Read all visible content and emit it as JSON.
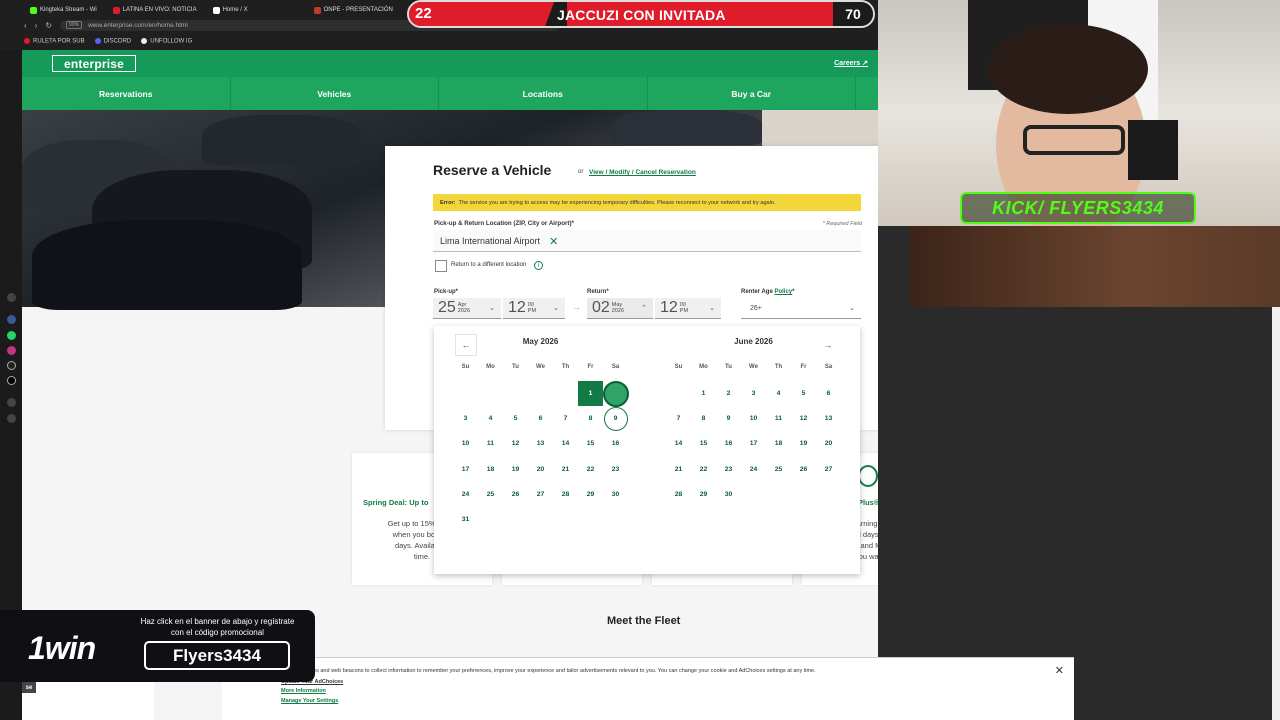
{
  "browser": {
    "tabs": [
      {
        "label": "Kingteka Stream - Wi",
        "color": "#53fc18"
      },
      {
        "label": "LATINA EN VIVO: NOTICIA",
        "color": "#e01b2a"
      },
      {
        "label": "Home / X",
        "color": "#ffffff"
      },
      {
        "label": "ONPE - PRESENTACIÓN",
        "color": "#c0392b"
      }
    ],
    "url": "www.enterprise.com/en/home.html",
    "zoom": "90%",
    "bookmarks": [
      "RULETA POR SUB",
      "DISCORD",
      "UNFOLLOW IG"
    ]
  },
  "site": {
    "logo": "enterprise",
    "careers": "Careers",
    "nav": [
      "Reservations",
      "Vehicles",
      "Locations",
      "Buy a Car"
    ]
  },
  "reservation": {
    "title": "Reserve a Vehicle",
    "or": "or",
    "modify_link": "View / Modify / Cancel Reservation",
    "error_label": "Error:",
    "error_text": "The service you are trying to access may be experiencing temporary difficulties. Please reconnect to your network and try again.",
    "location_label": "Pick-up & Return Location (ZIP, City or Airport)*",
    "required": "* Required Field",
    "location_value": "Lima International Airport",
    "return_diff": "Return to a different location",
    "pickup_label": "Pick-up*",
    "return_label": "Return*",
    "age_label": "Renter Age",
    "age_policy": "Policy",
    "pickup_day": "25",
    "pickup_month": "Apr",
    "pickup_year": "2026",
    "pickup_hour": "12",
    "pickup_min": "00",
    "pickup_ampm": "PM",
    "return_day": "02",
    "return_month": "May",
    "return_year": "2026",
    "return_hour": "12",
    "return_min": "00",
    "return_ampm": "PM",
    "age_value": "26+"
  },
  "calendar": {
    "dow": [
      "Su",
      "Mo",
      "Tu",
      "We",
      "Th",
      "Fr",
      "Sa"
    ],
    "months": [
      {
        "title": "May 2026",
        "offset": 5,
        "days": 31
      },
      {
        "title": "June 2026",
        "offset": 1,
        "days": 30
      }
    ]
  },
  "promos": {
    "spring_title": "Spring Deal: Up to",
    "spring_text": "Get up to 15% of the\nwhen you book fo\ndays. Available f\ntime.",
    "plus_title": "Plus® Program",
    "plus_text": "be earning points\nrental days (covers\nTime and Mileage,\nare you waiting for?"
  },
  "fleet_title": "Meet the Fleet",
  "cookie": {
    "text": "okies and web beacons to collect information to remember your preferences, improve your experience and tailor advertisements relevant to you. You can change your cookie and AdChoices settings at any time.",
    "update": "Update Your AdChoices",
    "more": "More Information",
    "manage": "Manage Your Settings"
  },
  "overlay": {
    "live_left": "22",
    "live_title": "JACCUZI CON INVITADA",
    "live_right": "70",
    "kick": "KICK/ FLYERS3434",
    "onewin_logo": "1win",
    "onewin_msg": "Haz click en el banner de abajo y regístrate con el código promocional",
    "onewin_code": "Flyers3434",
    "corner_tag": "se"
  },
  "colors": {
    "brand_green": "#169a5a",
    "dark_green": "#117a45",
    "error_yellow": "#f2d63a",
    "live_red": "#e01b2a",
    "kick_green": "#53fc18"
  }
}
